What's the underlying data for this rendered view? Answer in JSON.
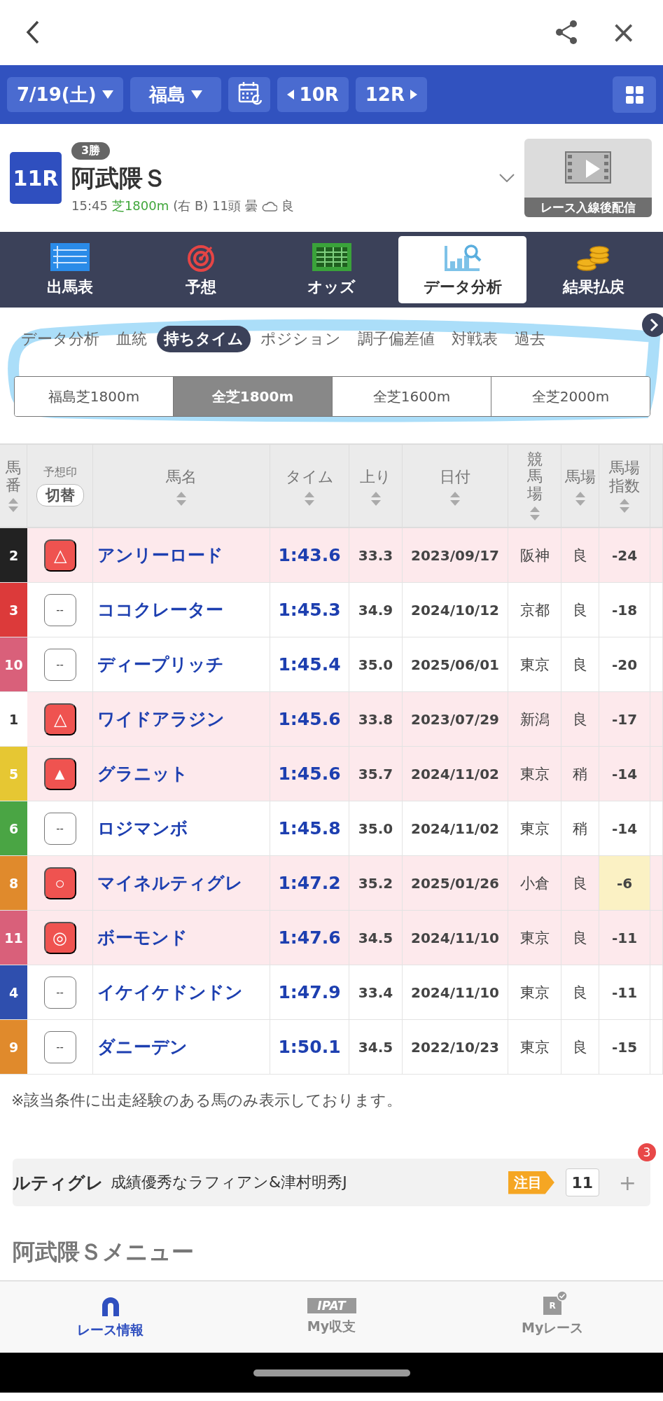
{
  "top_bar": {
    "close": "×"
  },
  "race_bar": {
    "date": "7/19(土)",
    "venue": "福島",
    "prev_race": "10R",
    "next_race": "12R"
  },
  "race": {
    "number": "11R",
    "class": "3勝",
    "name": "阿武隈Ｓ",
    "time": "15:45",
    "course": "芝1800m",
    "details": "(右 B) 11頭 曇",
    "going": "良",
    "video_label": "レース入線後配信"
  },
  "nav_tabs": [
    {
      "label": "出馬表",
      "selected": false
    },
    {
      "label": "予想",
      "selected": false
    },
    {
      "label": "オッズ",
      "selected": false
    },
    {
      "label": "データ分析",
      "selected": true
    },
    {
      "label": "結果払戻",
      "selected": false
    }
  ],
  "sub_tabs": [
    {
      "label": "データ分析",
      "selected": false
    },
    {
      "label": "血統",
      "selected": false
    },
    {
      "label": "持ちタイム",
      "selected": true
    },
    {
      "label": "ポジション",
      "selected": false
    },
    {
      "label": "調子偏差値",
      "selected": false
    },
    {
      "label": "対戦表",
      "selected": false
    },
    {
      "label": "過去",
      "selected": false
    }
  ],
  "course_filter": [
    {
      "label": "福島芝1800m",
      "selected": false
    },
    {
      "label": "全芝1800m",
      "selected": true
    },
    {
      "label": "全芝1600m",
      "selected": false
    },
    {
      "label": "全芝2000m",
      "selected": false
    }
  ],
  "table": {
    "columns": [
      "馬番",
      "予想印",
      "馬名",
      "タイム",
      "上り",
      "日付",
      "競馬場",
      "馬場",
      "馬場指数"
    ],
    "toggle": "切替",
    "rows": [
      {
        "number": "2",
        "color": "#222222",
        "mark": "△",
        "kind": "pick",
        "name": "アンリーロード",
        "time": "1:43.6",
        "last3f": "33.3",
        "date": "2023/09/17",
        "track": "阪神",
        "going": "良",
        "index": "-24",
        "highlighted": true,
        "index_highlighted": false
      },
      {
        "number": "3",
        "color": "#dc3a3a",
        "mark": "--",
        "kind": "none",
        "name": "ココクレーター",
        "time": "1:45.3",
        "last3f": "34.9",
        "date": "2024/10/12",
        "track": "京都",
        "going": "良",
        "index": "-18",
        "highlighted": false,
        "index_highlighted": false
      },
      {
        "number": "10",
        "color": "#d9607a",
        "mark": "--",
        "kind": "none",
        "name": "ディープリッチ",
        "time": "1:45.4",
        "last3f": "35.0",
        "date": "2025/06/01",
        "track": "東京",
        "going": "良",
        "index": "-20",
        "highlighted": false,
        "index_highlighted": false
      },
      {
        "number": "1",
        "color": "#ffffff",
        "mark": "△",
        "kind": "pick",
        "name": "ワイドアラジン",
        "time": "1:45.6",
        "last3f": "33.8",
        "date": "2023/07/29",
        "track": "新潟",
        "going": "良",
        "index": "-17",
        "highlighted": true,
        "index_highlighted": false
      },
      {
        "number": "5",
        "color": "#e6c733",
        "mark": "▲",
        "kind": "pick",
        "name": "グラニット",
        "time": "1:45.6",
        "last3f": "35.7",
        "date": "2024/11/02",
        "track": "東京",
        "going": "稍",
        "index": "-14",
        "highlighted": true,
        "index_highlighted": false
      },
      {
        "number": "6",
        "color": "#4aa544",
        "mark": "--",
        "kind": "none",
        "name": "ロジマンボ",
        "time": "1:45.8",
        "last3f": "35.0",
        "date": "2024/11/02",
        "track": "東京",
        "going": "稍",
        "index": "-14",
        "highlighted": false,
        "index_highlighted": false
      },
      {
        "number": "8",
        "color": "#e08a2c",
        "mark": "○",
        "kind": "pick",
        "name": "マイネルティグレ",
        "time": "1:47.2",
        "last3f": "35.2",
        "date": "2025/01/26",
        "track": "小倉",
        "going": "良",
        "index": "-6",
        "highlighted": true,
        "index_highlighted": true
      },
      {
        "number": "11",
        "color": "#d9607a",
        "mark": "◎",
        "kind": "pick",
        "name": "ボーモンド",
        "time": "1:47.6",
        "last3f": "34.5",
        "date": "2024/11/10",
        "track": "東京",
        "going": "良",
        "index": "-11",
        "highlighted": true,
        "index_highlighted": false
      },
      {
        "number": "4",
        "color": "#2f4fae",
        "mark": "--",
        "kind": "none",
        "name": "イケイケドンドン",
        "time": "1:47.9",
        "last3f": "33.4",
        "date": "2024/11/10",
        "track": "東京",
        "going": "良",
        "index": "-11",
        "highlighted": false,
        "index_highlighted": false
      },
      {
        "number": "9",
        "color": "#e08a2c",
        "mark": "--",
        "kind": "none",
        "name": "ダニーデン",
        "time": "1:50.1",
        "last3f": "34.5",
        "date": "2022/10/23",
        "track": "東京",
        "going": "良",
        "index": "-15",
        "highlighted": false,
        "index_highlighted": false
      }
    ]
  },
  "note": "※該当条件に出走経験のある馬のみ表示しております。",
  "news_card": {
    "horse": "ルティグレ",
    "headline": "成績優秀なラフィアン&津村明秀J",
    "tag": "注目",
    "count": "11",
    "plus": "+",
    "badge": "3"
  },
  "menu_title": "阿武隈Ｓメニュー",
  "bottom_nav": [
    {
      "label": "レース情報",
      "selected": true
    },
    {
      "label": "My収支",
      "selected": false
    },
    {
      "label": "Myレース",
      "selected": false
    }
  ],
  "ipat_logo": "IPAT",
  "myrace_icon_letter": "R"
}
